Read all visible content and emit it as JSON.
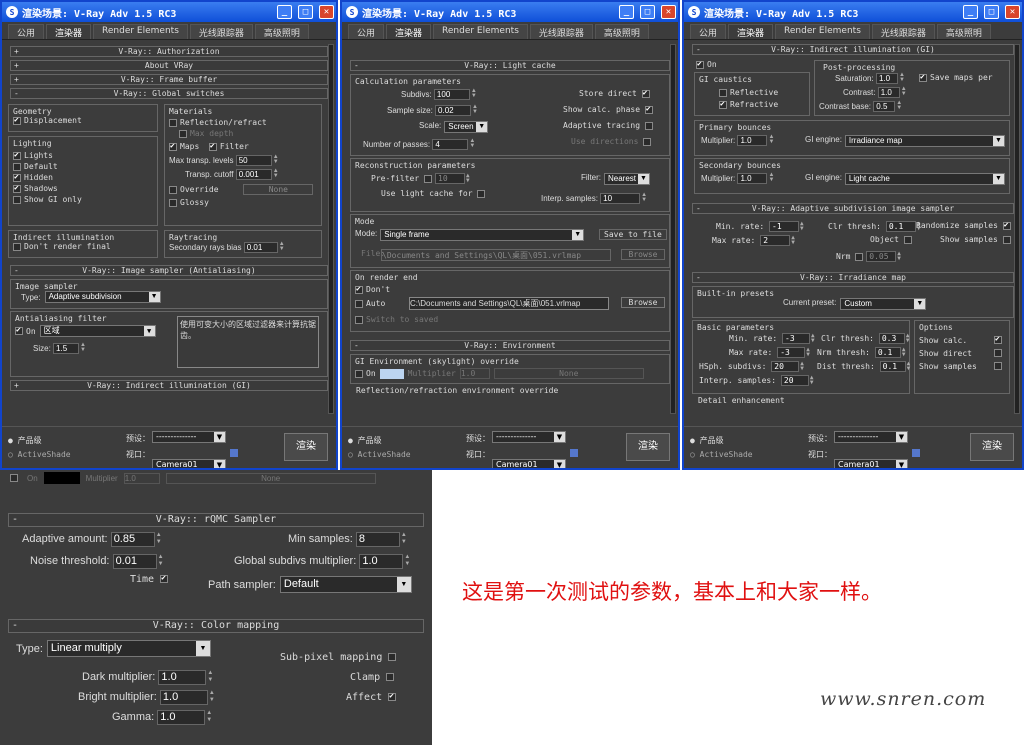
{
  "win_title": "渲染场景: V-Ray Adv 1.5 RC3",
  "tabs": [
    "公用",
    "渲染器",
    "Render Elements",
    "光线跟踪器",
    "高级照明"
  ],
  "bottom": {
    "prod": "产品级",
    "active": "ActiveShade",
    "preset": "预设：",
    "preset_val": "--------------",
    "view": "视口：",
    "view_val": "Camera01",
    "render": "渲染"
  },
  "w1": {
    "r1": "V-Ray:: Authorization",
    "r2": "About VRay",
    "r3": "V-Ray:: Frame buffer",
    "r4": "V-Ray:: Global switches",
    "geometry": "Geometry",
    "displacement": "Displacement",
    "lighting": "Lighting",
    "lights": "Lights",
    "default": "Default",
    "hidden": "Hidden",
    "shadows": "Shadows",
    "show_gi": "Show GI only",
    "materials": "Materials",
    "reflrefr": "Reflection/refract",
    "maxdepth": "Max depth",
    "maps": "Maps",
    "filter": "Filter",
    "max_transp": "Max transp. levels",
    "max_transp_v": "50",
    "transp_cut": "Transp. cutoff",
    "transp_cut_v": "0.001",
    "override": "Override",
    "none": "None",
    "glossy": "Glossy",
    "indirect": "Indirect illumination",
    "dont_render": "Don't render final",
    "raytracing": "Raytracing",
    "sec_bias": "Secondary rays bias",
    "sec_bias_v": "0.01",
    "r5": "V-Ray:: Image sampler (Antialiasing)",
    "img_sampler": "Image sampler",
    "type": "Type:",
    "type_v": "Adaptive subdivision",
    "aa_filter": "Antialiasing filter",
    "on": "On",
    "filt_v": "区域",
    "filt_desc": "使用可变大小的区域过滤器来计算抗锯齿。",
    "size": "Size:",
    "size_v": "1.5",
    "r6": "V-Ray:: Indirect illumination (GI)"
  },
  "w2": {
    "r1": "V-Ray:: Light cache",
    "calc": "Calculation parameters",
    "subdivs": "Subdivs:",
    "subdivs_v": "100",
    "sample": "Sample size:",
    "sample_v": "0.02",
    "scale": "Scale:",
    "scale_v": "Screen",
    "passes": "Number of passes:",
    "passes_v": "4",
    "store": "Store direct",
    "show_calc": "Show calc. phase",
    "adaptive": "Adaptive tracing",
    "use_dirs": "Use directions",
    "recon": "Reconstruction parameters",
    "prefilter": "Pre-filter",
    "prefilter_v": "10",
    "use_lc": "Use light cache for",
    "filter": "Filter:",
    "filter_v": "Nearest",
    "interp": "Interp. samples:",
    "interp_v": "10",
    "mode": "Mode",
    "mode_l": "Mode:",
    "mode_v": "Single frame",
    "save": "Save to file",
    "file": "File:",
    "file_v": "\\Documents and Settings\\QL\\桌面\\051.vrlmap",
    "browse": "Browse",
    "onend": "On render end",
    "dont": "Don't",
    "auto": "Auto",
    "auto_v": "C:\\Documents and Settings\\QL\\桌面\\051.vrlmap",
    "switch": "Switch to saved",
    "r2": "V-Ray:: Environment",
    "gienv": "GI Environment (skylight) override",
    "on": "On",
    "mult": "Multiplier",
    "mult_v": "1.0",
    "none": "None",
    "reflenv": "Reflection/refraction environment override"
  },
  "w3": {
    "r1": "V-Ray:: Indirect illumination (GI)",
    "on": "On",
    "gi_caustics": "GI caustics",
    "reflective": "Reflective",
    "refractive": "Refractive",
    "post": "Post-processing",
    "sat": "Saturation:",
    "sat_v": "1.0",
    "save_maps": "Save maps per",
    "contrast": "Contrast:",
    "contrast_v": "1.0",
    "cbase": "Contrast base:",
    "cbase_v": "0.5",
    "primary": "Primary bounces",
    "mult": "Multiplier:",
    "mult1_v": "1.0",
    "gi_engine": "GI engine:",
    "eng1_v": "Irradiance map",
    "secondary": "Secondary bounces",
    "mult2_v": "1.0",
    "eng2_v": "Light cache",
    "r2": "V-Ray:: Adaptive subdivision image sampler",
    "minrate": "Min. rate:",
    "minrate_v": "-1",
    "maxrate": "Max rate:",
    "maxrate_v": "2",
    "clr": "Clr thresh:",
    "clr_v": "0.1",
    "rand": "Randomize samples",
    "object": "Object",
    "show_samples": "Show samples",
    "nrm": "Nrm",
    "nrm_v": "0.05",
    "r3": "V-Ray:: Irradiance map",
    "presets": "Built-in presets",
    "cur_preset": "Current preset:",
    "cur_preset_v": "Custom",
    "basic": "Basic parameters",
    "min2_v": "-3",
    "max2_v": "-3",
    "clr2": "Clr thresh:",
    "clr2_v": "0.3",
    "nrm2": "Nrm thresh:",
    "nrm2_v": "0.1",
    "hsph": "HSph. subdivs:",
    "hsph_v": "20",
    "dist": "Dist thresh:",
    "dist_v": "0.1",
    "interp": "Interp. samples:",
    "interp_v": "20",
    "options": "Options",
    "show_calc": "Show calc.",
    "show_direct": "Show direct",
    "show_samp": "Show samples",
    "detail": "Detail enhancement"
  },
  "w4": {
    "on": "On",
    "mult": "Multiplier",
    "mult_v": "1.0",
    "none": "None",
    "r1": "V-Ray:: rQMC Sampler",
    "adapt": "Adaptive amount:",
    "adapt_v": "0.85",
    "noise": "Noise threshold:",
    "noise_v": "0.01",
    "time": "Time",
    "minsamp": "Min samples:",
    "minsamp_v": "8",
    "gsub": "Global subdivs multiplier:",
    "gsub_v": "1.0",
    "path": "Path sampler:",
    "path_v": "Default",
    "r2": "V-Ray:: Color mapping",
    "type": "Type:",
    "type_v": "Linear multiply",
    "dark": "Dark multiplier:",
    "dark_v": "1.0",
    "bright": "Bright multiplier:",
    "bright_v": "1.0",
    "gamma": "Gamma:",
    "gamma_v": "1.0",
    "subpix": "Sub-pixel mapping",
    "clamp": "Clamp",
    "affect": "Affect"
  },
  "caption": "这是第一次测试的参数，基本上和大家一样。",
  "watermark": "www.snren.com",
  "colors": {
    "caption": "#e01010",
    "border": "#1144cc"
  }
}
